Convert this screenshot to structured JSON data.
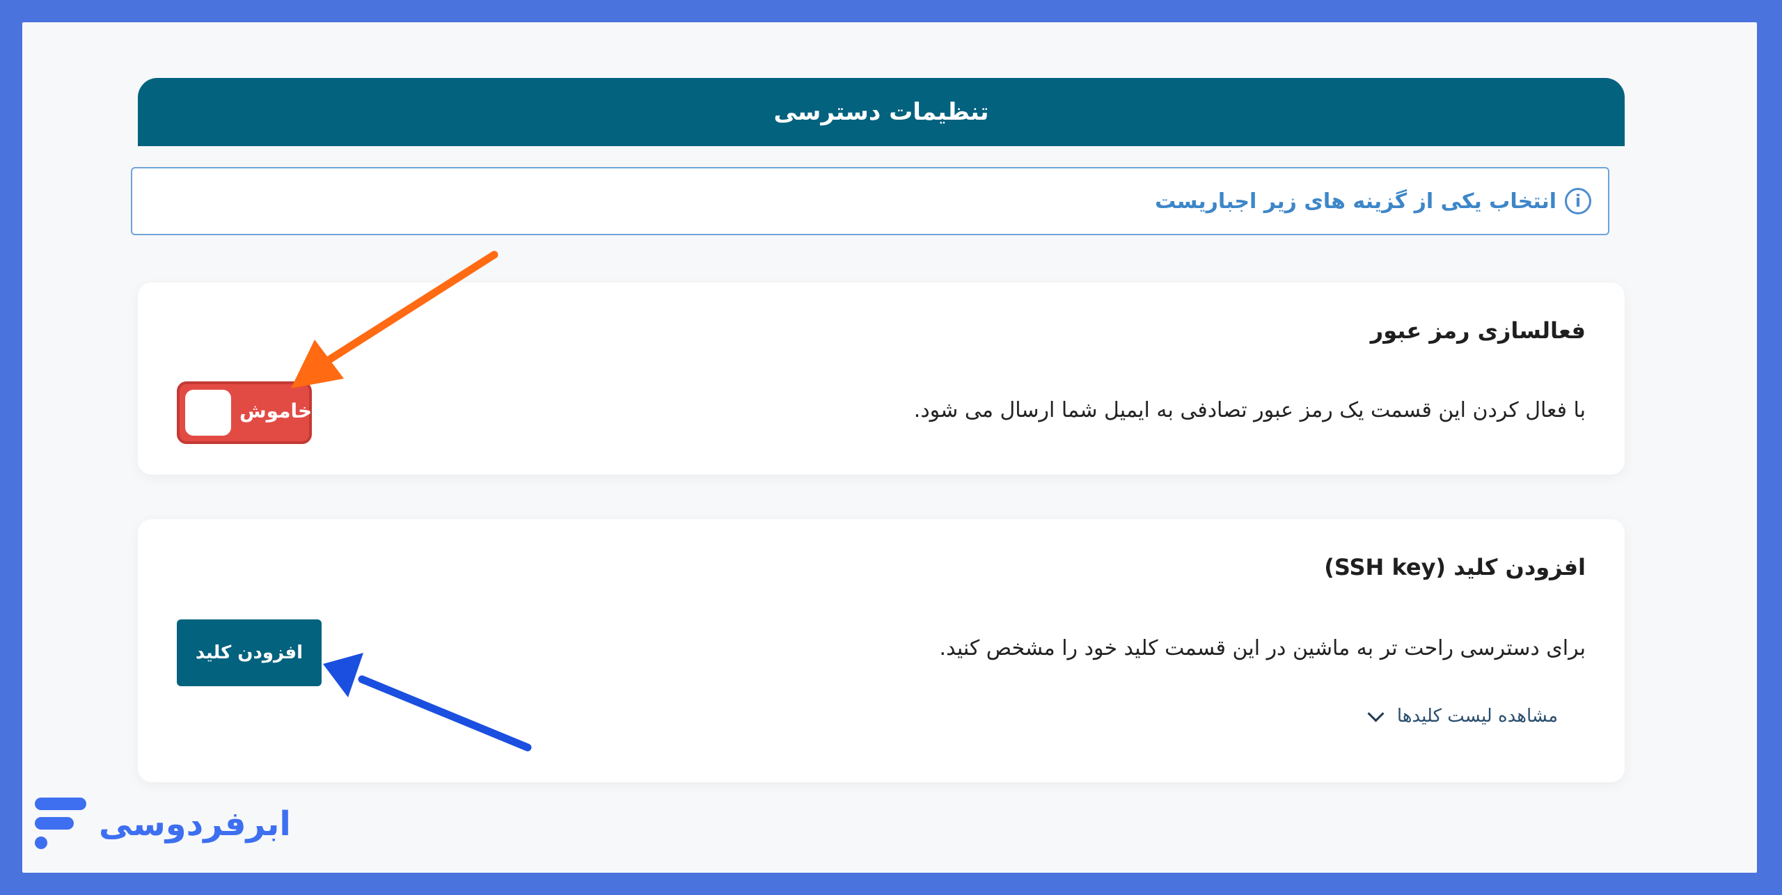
{
  "header": {
    "title": "تنظیمات دسترسی"
  },
  "notice": {
    "icon": "info-icon",
    "text": "انتخاب یکی از گزینه های زیر اجباریست"
  },
  "password_card": {
    "title": "فعالسازی رمز عبور",
    "description": "با فعال کردن این قسمت یک رمز عبور تصادفی به ایمیل شما ارسال می شود.",
    "toggle_label": "خاموش",
    "toggle_color": "#e24b44"
  },
  "ssh_card": {
    "title": "افزودن کلید (SSH key)",
    "description": "برای دسترسی راحت تر به ماشین در این قسمت کلید خود را مشخص کنید.",
    "button_label": "افزودن کلید",
    "list_link": "مشاهده لیست کلیدها"
  },
  "brand": {
    "name": "ابرفردوسی",
    "color": "#3d6ff0"
  },
  "colors": {
    "primary": "#03627e",
    "frame": "#4a73de",
    "orange_arrow": "#ff6a13",
    "blue_arrow": "#1a4fe0"
  }
}
